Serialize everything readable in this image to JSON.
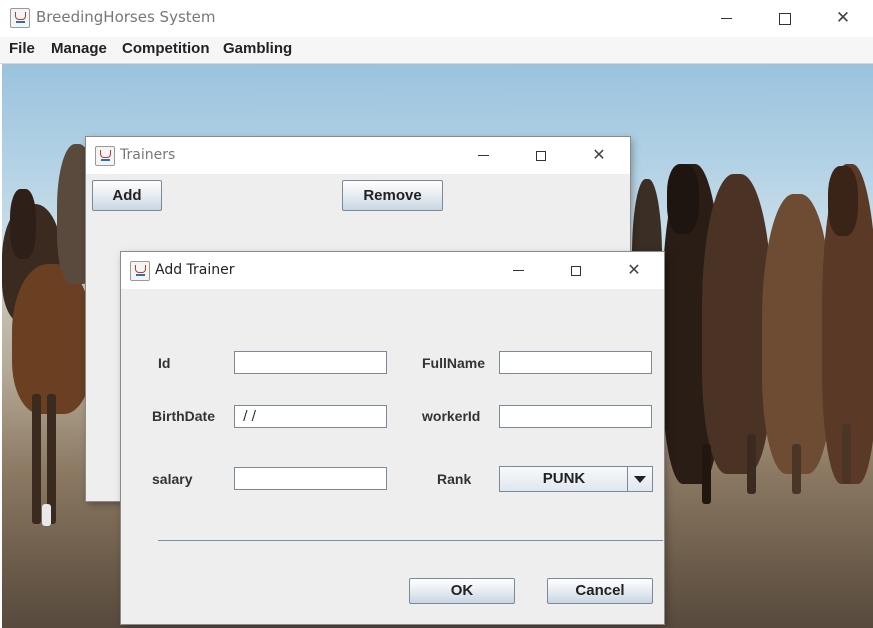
{
  "app": {
    "title": "BreedingHorses System"
  },
  "menu": [
    "File",
    "Manage",
    "Competition",
    "Gambling"
  ],
  "trainers_window": {
    "title": "Trainers",
    "add_label": "Add",
    "remove_label": "Remove"
  },
  "add_trainer": {
    "title": "Add Trainer",
    "fields": {
      "id": {
        "label": "Id",
        "value": ""
      },
      "fullname": {
        "label": "FullName",
        "value": ""
      },
      "birthdate": {
        "label": "BirthDate",
        "value": " / /"
      },
      "workerid": {
        "label": "workerId",
        "value": ""
      },
      "salary": {
        "label": "salary",
        "value": ""
      },
      "rank": {
        "label": "Rank",
        "selected": "PUNK"
      }
    },
    "ok_label": "OK",
    "cancel_label": "Cancel"
  },
  "window_controls": {
    "minimize": "—",
    "maximize": "☐",
    "close": "✕"
  },
  "colors": {
    "button_border": "#7a8a99",
    "dialog_bg": "#eeeeee",
    "separator": "#7a8fa8"
  }
}
